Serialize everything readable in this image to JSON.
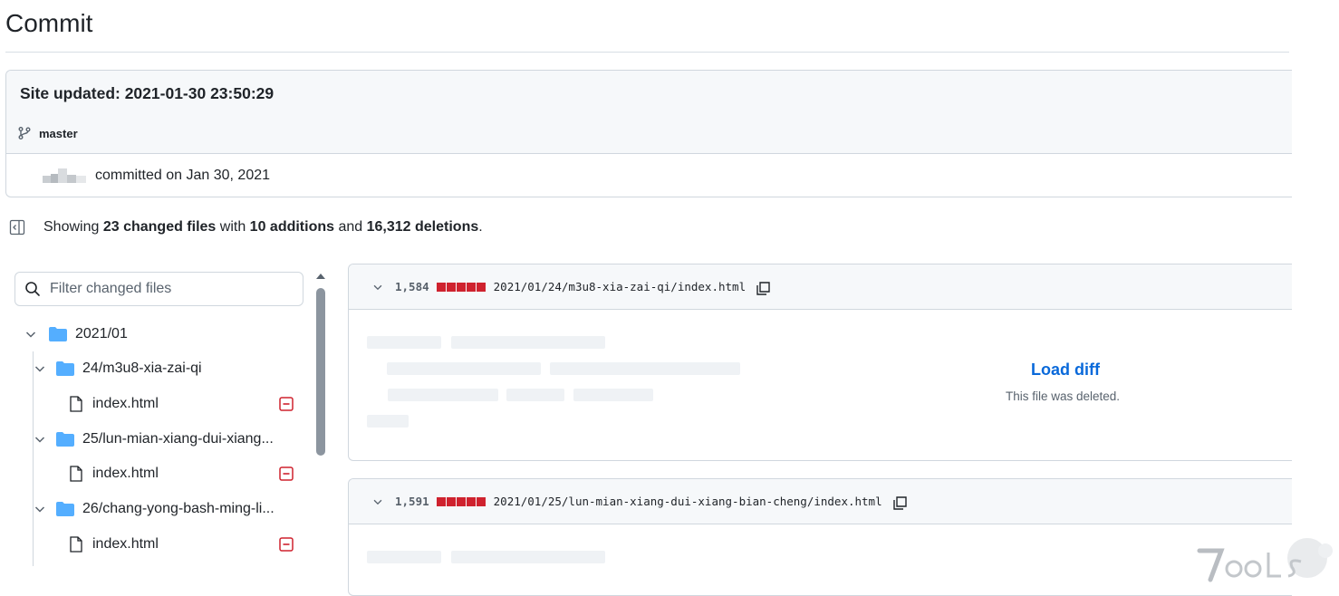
{
  "page": {
    "title": "Commit"
  },
  "commit": {
    "message": "Site updated: 2021-01-30 23:50:29",
    "branch": "master",
    "committed_text": "committed on Jan 30, 2021"
  },
  "summary": {
    "prefix": "Showing ",
    "changed_files": "23 changed files",
    "mid1": " with ",
    "additions": "10 additions",
    "mid2": " and ",
    "deletions": "16,312 deletions",
    "suffix": "."
  },
  "file_tree": {
    "filter_placeholder": "Filter changed files",
    "root_folder": "2021/01",
    "folders": [
      {
        "name": "24/m3u8-xia-zai-qi",
        "file": "index.html"
      },
      {
        "name": "25/lun-mian-xiang-dui-xiang...",
        "file": "index.html"
      },
      {
        "name": "26/chang-yong-bash-ming-li...",
        "file": "index.html"
      }
    ]
  },
  "diffs": [
    {
      "count": "1,584",
      "path": "2021/01/24/m3u8-xia-zai-qi/index.html",
      "load_label": "Load diff",
      "note": "This file was deleted."
    },
    {
      "count": "1,591",
      "path": "2021/01/25/lun-mian-xiang-dui-xiang-bian-cheng/index.html"
    }
  ],
  "colors": {
    "deletion": "#cf222e",
    "link": "#0969da",
    "folder": "#54aeff",
    "border": "#d0d7de"
  },
  "icons": [
    "git-branch-icon",
    "sidebar-toggle-icon",
    "search-icon",
    "chevron-down-icon",
    "folder-icon",
    "file-icon",
    "file-deleted-icon",
    "copy-icon"
  ]
}
